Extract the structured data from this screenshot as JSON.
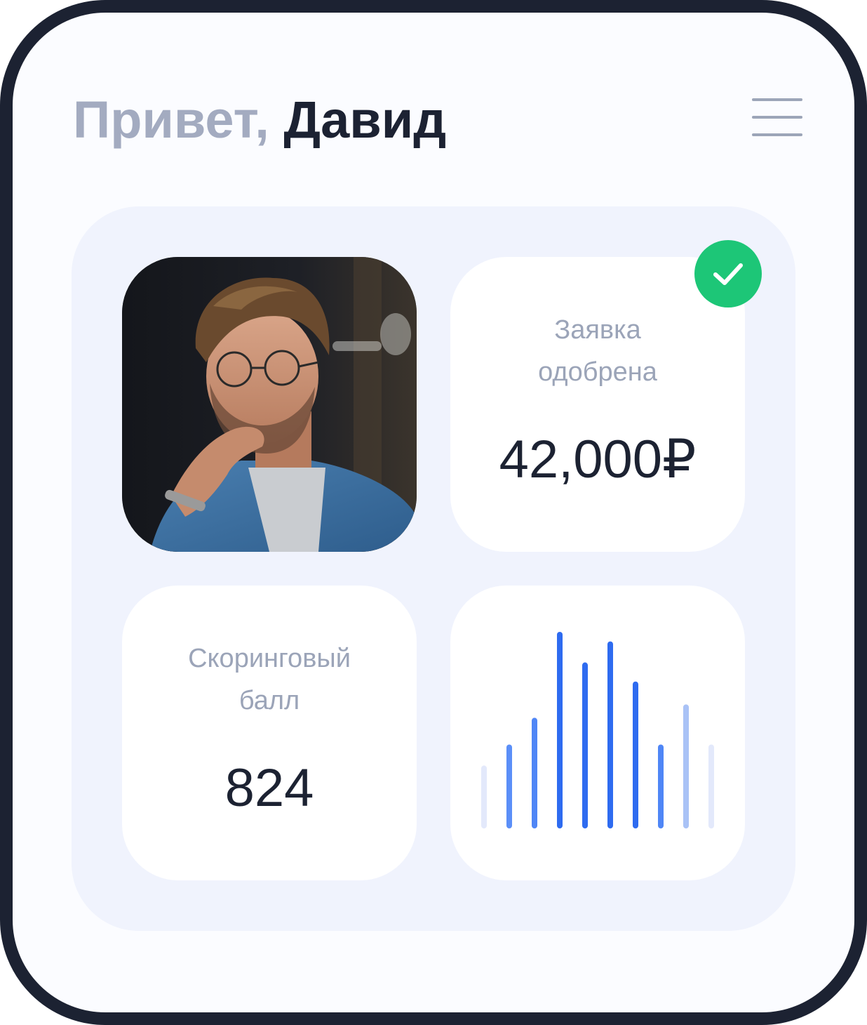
{
  "header": {
    "greeting_prefix": "Привет,",
    "user_name": "Давид"
  },
  "icons": {
    "menu": "hamburger-menu-icon",
    "approved": "checkmark-icon"
  },
  "cards": {
    "approval": {
      "label_line1": "Заявка",
      "label_line2": "одобрена",
      "amount": "42,000₽"
    },
    "score": {
      "label_line1": "Скоринговый",
      "label_line2": "балл",
      "value": "824"
    },
    "activity_bars": [
      {
        "level": 0.3,
        "color": "#e3e9fb"
      },
      {
        "level": 0.41,
        "color": "#5b8ff8"
      },
      {
        "level": 0.55,
        "color": "#4f86f6"
      },
      {
        "level": 1.0,
        "color": "#2e6bf0"
      },
      {
        "level": 0.84,
        "color": "#2e6bf0"
      },
      {
        "level": 0.95,
        "color": "#2e6bf0"
      },
      {
        "level": 0.74,
        "color": "#2e6bf0"
      },
      {
        "level": 0.41,
        "color": "#4f86f6"
      },
      {
        "level": 0.62,
        "color": "#a9c2f6"
      },
      {
        "level": 0.41,
        "color": "#e3e9fb"
      }
    ]
  },
  "colors": {
    "frame": "#1c2232",
    "accent_green": "#1dc677",
    "accent_blue": "#2e6bf0",
    "muted_text": "#9ba4b8"
  }
}
